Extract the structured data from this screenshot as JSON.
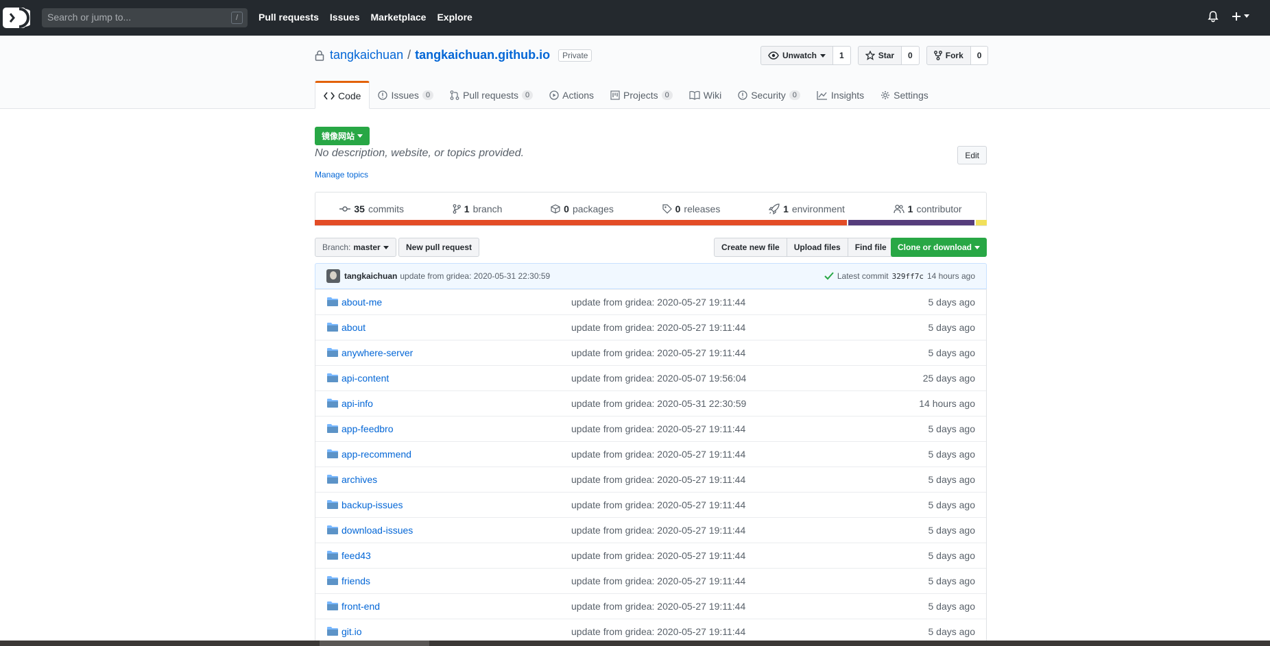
{
  "topbar": {
    "search_placeholder": "Search or jump to...",
    "search_shortcut": "/",
    "nav": [
      "Pull requests",
      "Issues",
      "Marketplace",
      "Explore"
    ],
    "plus_label": "+"
  },
  "repo": {
    "owner": "tangkaichuan",
    "separator": "/",
    "name": "tangkaichuan.github.io",
    "visibility": "Private",
    "watch_label": "Unwatch",
    "watch_count": "1",
    "star_label": "Star",
    "star_count": "0",
    "fork_label": "Fork",
    "fork_count": "0"
  },
  "tabs": [
    {
      "label": "Code",
      "count": "",
      "icon": "code-icon"
    },
    {
      "label": "Issues",
      "count": "0",
      "icon": "issue-icon"
    },
    {
      "label": "Pull requests",
      "count": "0",
      "icon": "pull-request-icon"
    },
    {
      "label": "Actions",
      "count": "",
      "icon": "play-icon"
    },
    {
      "label": "Projects",
      "count": "0",
      "icon": "project-icon"
    },
    {
      "label": "Wiki",
      "count": "",
      "icon": "book-icon"
    },
    {
      "label": "Security",
      "count": "0",
      "icon": "shield-icon"
    },
    {
      "label": "Insights",
      "count": "",
      "icon": "graph-icon"
    },
    {
      "label": "Settings",
      "count": "",
      "icon": "gear-icon"
    }
  ],
  "main": {
    "mirror_label": "镜像网站",
    "description": "No description, website, or topics provided.",
    "manage_topics": "Manage topics",
    "edit_label": "Edit"
  },
  "summary": {
    "commits_count": "35",
    "commits_label": "commits",
    "branch_count": "1",
    "branch_label": "branch",
    "packages_count": "0",
    "packages_label": "packages",
    "releases_count": "0",
    "releases_label": "releases",
    "environment_count": "1",
    "environment_label": "environment",
    "contributor_count": "1",
    "contributor_label": "contributor"
  },
  "languages": {
    "colors": [
      "#e34c26",
      "#563d7c",
      "#f1e05a"
    ],
    "shares": [
      0.795,
      0.189,
      0.016
    ]
  },
  "branch": {
    "label": "Branch:",
    "value": "master",
    "new_pr": "New pull request",
    "create_file": "Create new file",
    "upload_files": "Upload files",
    "find_file": "Find file",
    "clone": "Clone or download"
  },
  "commit": {
    "author": "tangkaichuan",
    "message": "update from gridea: 2020-05-31 22:30:59",
    "latest_label": "Latest commit",
    "sha": "329ff7c",
    "age": "14 hours ago"
  },
  "files": [
    {
      "name": "about-me",
      "message": "update from gridea: 2020-05-27 19:11:44",
      "age": "5 days ago"
    },
    {
      "name": "about",
      "message": "update from gridea: 2020-05-27 19:11:44",
      "age": "5 days ago"
    },
    {
      "name": "anywhere-server",
      "message": "update from gridea: 2020-05-27 19:11:44",
      "age": "5 days ago"
    },
    {
      "name": "api-content",
      "message": "update from gridea: 2020-05-07 19:56:04",
      "age": "25 days ago"
    },
    {
      "name": "api-info",
      "message": "update from gridea: 2020-05-31 22:30:59",
      "age": "14 hours ago"
    },
    {
      "name": "app-feedbro",
      "message": "update from gridea: 2020-05-27 19:11:44",
      "age": "5 days ago"
    },
    {
      "name": "app-recommend",
      "message": "update from gridea: 2020-05-27 19:11:44",
      "age": "5 days ago"
    },
    {
      "name": "archives",
      "message": "update from gridea: 2020-05-27 19:11:44",
      "age": "5 days ago"
    },
    {
      "name": "backup-issues",
      "message": "update from gridea: 2020-05-27 19:11:44",
      "age": "5 days ago"
    },
    {
      "name": "download-issues",
      "message": "update from gridea: 2020-05-27 19:11:44",
      "age": "5 days ago"
    },
    {
      "name": "feed43",
      "message": "update from gridea: 2020-05-27 19:11:44",
      "age": "5 days ago"
    },
    {
      "name": "friends",
      "message": "update from gridea: 2020-05-27 19:11:44",
      "age": "5 days ago"
    },
    {
      "name": "front-end",
      "message": "update from gridea: 2020-05-27 19:11:44",
      "age": "5 days ago"
    },
    {
      "name": "git.io",
      "message": "update from gridea: 2020-05-27 19:11:44",
      "age": "5 days ago"
    }
  ]
}
